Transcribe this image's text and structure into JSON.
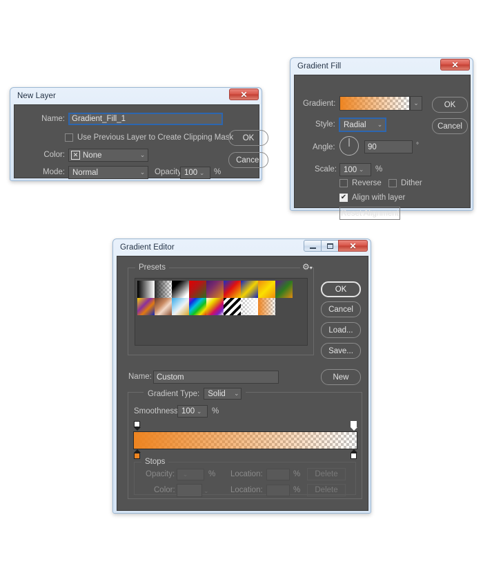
{
  "accents": {
    "orange": "#ee8420",
    "dark_panel": "#535353",
    "field": "#5e5e5e",
    "focus_blue": "#2c66b0",
    "aero_title": "#e4eefa"
  },
  "new_layer_dialog": {
    "title": "New Layer",
    "close_label": "✕",
    "name_label": "Name:",
    "name_value": "Gradient_Fill_1",
    "clipping_checkbox_label": "Use Previous Layer to Create Clipping Mask",
    "clipping_checked": false,
    "color_label": "Color:",
    "color_value": "None",
    "color_swatch_glyph": "✕",
    "mode_label": "Mode:",
    "mode_value": "Normal",
    "opacity_label": "Opacity:",
    "opacity_value": "100",
    "percent": "%",
    "ok_label": "OK",
    "cancel_label": "Cancel"
  },
  "gradient_fill_dialog": {
    "title": "Gradient Fill",
    "close_label": "✕",
    "gradient_label": "Gradient:",
    "style_label": "Style:",
    "style_value": "Radial",
    "angle_label": "Angle:",
    "angle_value": "90",
    "degree_symbol": "°",
    "scale_label": "Scale:",
    "scale_value": "100",
    "percent": "%",
    "reverse_label": "Reverse",
    "reverse_checked": false,
    "dither_label": "Dither",
    "dither_checked": false,
    "align_label": "Align with layer",
    "align_checked": true,
    "align_check_glyph": "✔",
    "reset_alignment_label": "Reset Alignment",
    "ok_label": "OK",
    "cancel_label": "Cancel"
  },
  "gradient_editor_dialog": {
    "title": "Gradient Editor",
    "minimize_label": "–",
    "maximize_label": "□",
    "close_label": "✕",
    "presets_group_label": "Presets",
    "presets_menu_icon": "gear-icon",
    "presets": [
      {
        "name": "foreground-to-background",
        "css": "linear-gradient(to right, #000000 0%, #ffffff 100%)",
        "alpha": false
      },
      {
        "name": "foreground-to-transparent",
        "css": "linear-gradient(to right, #2a2a2a 0%, rgba(42,42,42,0) 100%)",
        "alpha": true
      },
      {
        "name": "black-white",
        "css": "linear-gradient(to bottom right, #000000 25%, #ffffff 85%)",
        "alpha": false
      },
      {
        "name": "red-green",
        "css": "linear-gradient(to bottom right, #e00000 0%, #b41616 40%, #2d6b1f 100%)",
        "alpha": false
      },
      {
        "name": "violet-orange",
        "css": "linear-gradient(to bottom right, #4b1a6e 0%, #7a2b6b 35%, #e08a12 100%)",
        "alpha": false
      },
      {
        "name": "blue-red-yellow",
        "css": "linear-gradient(to bottom right, #1430c8 0%, #e01010 45%, #f5d300 100%)",
        "alpha": false
      },
      {
        "name": "blue-yellow-blue",
        "css": "linear-gradient(to bottom right, #1022c0 0%, #f3d200 50%, #1022c0 100%)",
        "alpha": false
      },
      {
        "name": "orange-yellow-orange",
        "css": "linear-gradient(to bottom right, #f08a10 0%, #fbe000 50%, #ef8a10 100%)",
        "alpha": false
      },
      {
        "name": "violet-green-orange",
        "css": "linear-gradient(to bottom right, #5d1a8c 0%, #2f7a20 50%, #e08a10 100%)",
        "alpha": false
      },
      {
        "name": "yellow-violet-orange-blue",
        "css": "linear-gradient(to bottom right, #f5d000 0%, #8a2f9c 40%, #e07a10 62%, #1028b8 100%)",
        "alpha": false
      },
      {
        "name": "copper",
        "css": "linear-gradient(to bottom right, #6b3a22 0%, #c98a62 40%, #f2d8c6 60%, #8a4f32 100%)",
        "alpha": false
      },
      {
        "name": "chrome",
        "css": "linear-gradient(to bottom right, #35a8e8 0%, #cfeaf7 45%, #f0f0f0 55%, #d8a52a 100%)",
        "alpha": false
      },
      {
        "name": "spectrum",
        "css": "linear-gradient(to bottom right, #e00090 0%, #1030e0 20%, #00c0e0 40%, #10c020 60%, #f0e000 80%, #e03010 100%)",
        "alpha": false
      },
      {
        "name": "transparent-rainbow",
        "css": "linear-gradient(to bottom right, #ffffff 0%, #f0e000 28%, #e08010 45%, #d01060 62%, #7a20c0 80%, rgba(120,32,192,0) 100%)",
        "alpha": true
      },
      {
        "name": "transparent-stripes",
        "css": "repeating-linear-gradient(-45deg, #000000 0px, #000000 4px, #ffffff 4px, #ffffff 8px)",
        "alpha": false
      },
      {
        "name": "transparent-to-white",
        "css": "linear-gradient(to right, rgba(255,255,255,0) 0%, rgba(255,255,255,0.92) 100%)",
        "alpha": true
      },
      {
        "name": "orange-to-transparent",
        "css": "linear-gradient(to right, #ee8420 0%, rgba(238,132,32,0) 100%)",
        "alpha": true
      }
    ],
    "name_label": "Name:",
    "name_value": "Custom",
    "gradient_type_label": "Gradient Type:",
    "gradient_type_value": "Solid",
    "smoothness_label": "Smoothness:",
    "smoothness_value": "100",
    "percent": "%",
    "degree_symbol": "°",
    "editor_gradient_css": "linear-gradient(to right, #ee8420 0%, rgba(238,132,32,0) 100%)",
    "stops_group_label": "Stops",
    "opacity_label": "Opacity:",
    "opacity_value": "",
    "color_label": "Color:",
    "location_label": "Location:",
    "location_top_value": "",
    "location_bottom_value": "",
    "delete_top_label": "Delete",
    "delete_bottom_label": "Delete",
    "ok_label": "OK",
    "cancel_label": "Cancel",
    "load_label": "Load...",
    "save_label": "Save...",
    "new_label": "New"
  }
}
